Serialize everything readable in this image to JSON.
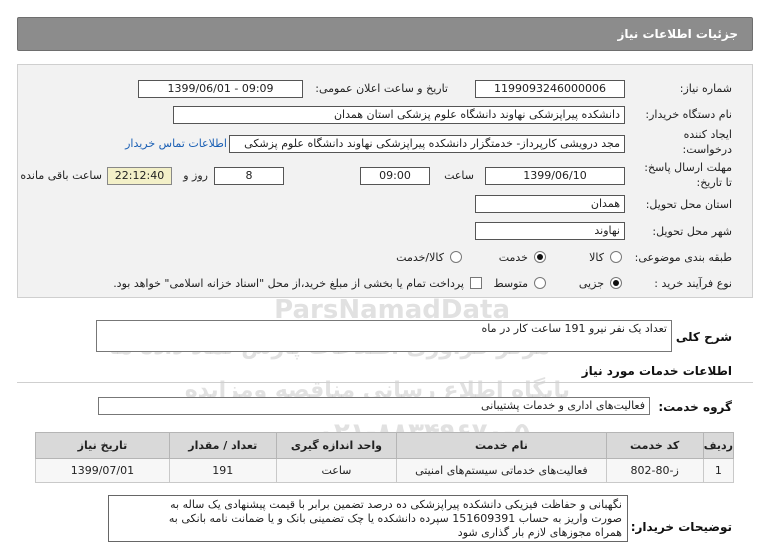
{
  "header": {
    "title": "جزئیات اطلاعات نیاز"
  },
  "fields": {
    "need_number_label": "شماره نیاز:",
    "need_number": "1199093246000006",
    "announce_label": "تاریخ و ساعت اعلان عمومی:",
    "announce_value": "1399/06/01 - 09:09",
    "buyer_label": "نام دستگاه خریدار:",
    "buyer_value": "دانشکده پیراپزشکی نهاوند دانشگاه علوم پزشکی استان همدان",
    "creator_label_1": "ایجاد کننده",
    "creator_label_2": "درخواست:",
    "creator_value": "مجد درویشی کارپرداز- خدمتگزار دانشکده پیراپزشکی نهاوند دانشگاه علوم پزشکی",
    "contact_link": "اطلاعات تماس خریدار",
    "deadline_label_1": "مهلت ارسال پاسخ:",
    "deadline_label_2": "تا تاریخ:",
    "deadline_date": "1399/06/10",
    "time_label": "ساعت",
    "deadline_time": "09:00",
    "days_value": "8",
    "days_label": "روز و",
    "remaining_time": "22:12:40",
    "remaining_label": "ساعت باقی مانده",
    "province_label": "استان محل تحویل:",
    "province_value": "همدان",
    "city_label": "شهر محل تحویل:",
    "city_value": "نهاوند",
    "category_label": "طبقه بندی موضوعی:",
    "category_options": [
      "کالا",
      "خدمت",
      "کالا/خدمت"
    ],
    "category_selected": "خدمت",
    "process_label": "نوع فرآیند خرید :",
    "process_options": [
      "جزیی",
      "متوسط"
    ],
    "process_selected": "جزیی",
    "payment_note": "پرداخت تمام یا بخشی از مبلغ خرید،از محل \"اسناد خزانه اسلامی\" خواهد بود."
  },
  "summary": {
    "label": "شرح کلی نیاز:",
    "value": "تعداد یک نفر نیرو 191 ساعت کار در ماه"
  },
  "services_section": {
    "title": "اطلاعات خدمات مورد نیاز"
  },
  "service_group": {
    "label": "گروه خدمت:",
    "value": "فعالیت‌های اداری و خدمات پشتیبانی"
  },
  "table": {
    "headers": [
      "ردیف",
      "کد خدمت",
      "نام خدمت",
      "واحد اندازه گیری",
      "تعداد / مقدار",
      "تاریخ نیاز"
    ],
    "rows": [
      [
        "1",
        "ز-80-802",
        "فعالیت‌های خدماتی سیستم‌های امنیتی",
        "ساعت",
        "191",
        "1399/07/01"
      ]
    ]
  },
  "notes": {
    "label": "توضیحات خریدار:",
    "lines": [
      "نگهبانی و حفاظت فیزیکی دانشکده پیراپزشکی ده درصد تضمین برابر با قیمت پیشنهادی یک ساله به",
      "صورت واریز به حساب 151609391 سپرده دانشکده یا چک تضمینی بانک و یا ضمانت نامه بانکی به",
      "همراه مجوزهای لازم بار گذاری شود"
    ]
  },
  "watermark": {
    "line1": "ParsNamadData",
    "line2": "مرکز فراوری اطلاعات پارس نماد داده ها",
    "line3": "پایگاه اطلاع رسانی مناقصه ومزایده",
    "line4": "۰۲۱-۸۸۳۴۹۶۷۰-۵"
  }
}
